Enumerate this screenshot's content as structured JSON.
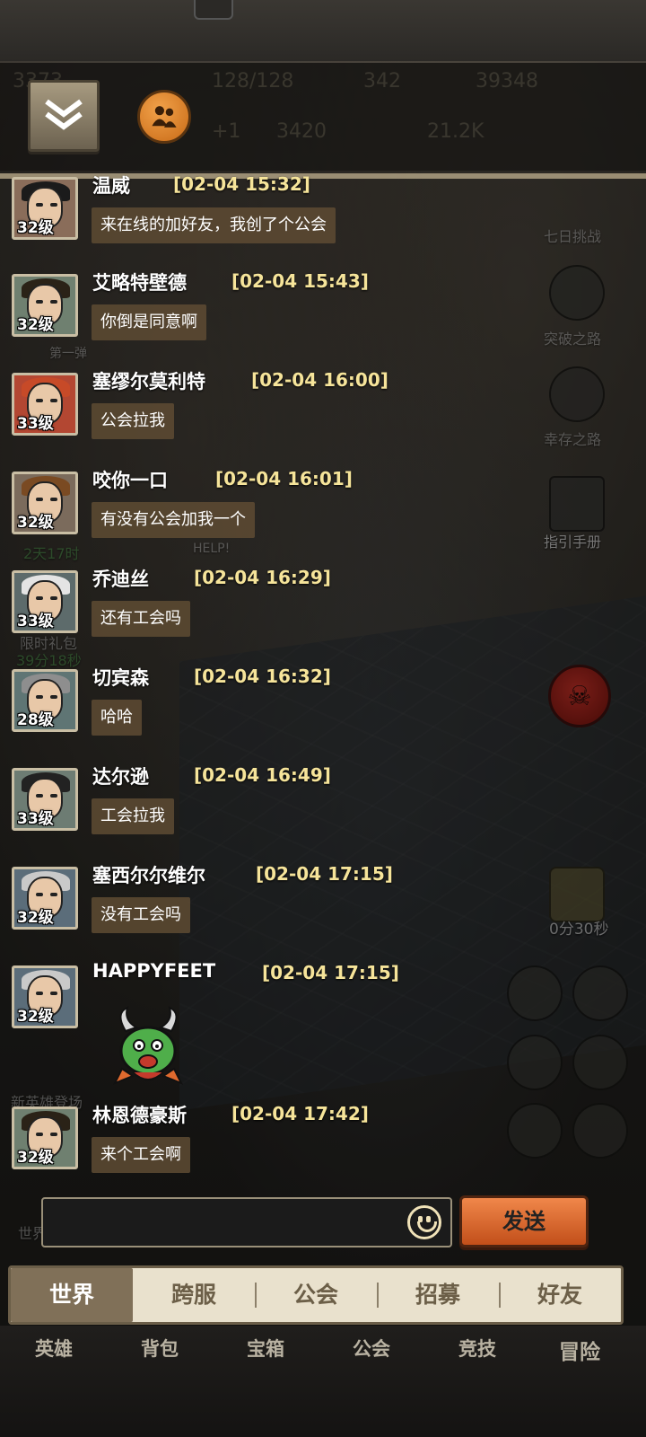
{
  "header": {
    "stats": [
      "3373",
      "128/128",
      "342",
      "39348",
      "3420",
      "+1",
      "21.2K"
    ],
    "collapse_icon": "double-chevron-down-icon",
    "friends_icon": "friends-icon"
  },
  "background": {
    "side_labels": [
      "七日挑战",
      "突破之路",
      "幸存之路",
      "指引手册",
      "0分30秒",
      "新英雄登场",
      "2天17时",
      "限时礼包",
      "39分18秒",
      "HELP!",
      "第一弹",
      "世界"
    ]
  },
  "messages": [
    {
      "name": "温威",
      "time": "[02-04  15:32]",
      "level": "32级",
      "text": "来在线的加好友，我创了个公会",
      "avatar_color": "#8a6d5a",
      "hair": "#1b1b1b"
    },
    {
      "name": "艾略特壁德",
      "time": "[02-04  15:43]",
      "level": "32级",
      "text": "你倒是同意啊",
      "avatar_color": "#6f8070",
      "hair": "#2a2217"
    },
    {
      "name": "塞缪尔莫利特",
      "time": "[02-04  16:00]",
      "level": "33级",
      "text": "公会拉我",
      "avatar_color": "#b34732",
      "hair": "#c74a28"
    },
    {
      "name": "咬你一口",
      "time": "[02-04  16:01]",
      "level": "32级",
      "text": "有没有公会加我一个",
      "avatar_color": "#7b6b5c",
      "hair": "#7a4a22"
    },
    {
      "name": "乔迪丝",
      "time": "[02-04  16:29]",
      "level": "33级",
      "text": "还有工会吗",
      "avatar_color": "#5d6b6b",
      "hair": "#e4e4e4"
    },
    {
      "name": "切宾森",
      "time": "[02-04  16:32]",
      "level": "28级",
      "text": "哈哈",
      "avatar_color": "#5f7574",
      "hair": "#8e8e8e"
    },
    {
      "name": "达尔逊",
      "time": "[02-04  16:49]",
      "level": "33级",
      "text": "工会拉我",
      "avatar_color": "#6d7c73",
      "hair": "#222222"
    },
    {
      "name": "塞西尔尔维尔",
      "time": "[02-04  17:15]",
      "level": "32级",
      "text": "没有工会吗",
      "avatar_color": "#5b6d7a",
      "hair": "#c9c9c9"
    },
    {
      "name": "HAPPYFEET",
      "time": "[02-04  17:15]",
      "level": "32级",
      "text": "",
      "avatar_color": "#5b6d7a",
      "hair": "#c9c9c9"
    },
    {
      "name": "林恩德豪斯",
      "time": "[02-04  17:42]",
      "level": "32级",
      "text": "来个工会啊",
      "avatar_color": "#6f8070",
      "hair": "#2a2217"
    }
  ],
  "sticker": {
    "icon": "green-monster-sticker-icon"
  },
  "input": {
    "placeholder": "",
    "emoji_icon": "smiley-icon",
    "send_label": "发送"
  },
  "tabs": [
    {
      "label": "世界",
      "active": true
    },
    {
      "label": "跨服",
      "active": false
    },
    {
      "label": "公会",
      "active": false
    },
    {
      "label": "招募",
      "active": false
    },
    {
      "label": "好友",
      "active": false
    }
  ],
  "bottom_nav": [
    "英雄",
    "背包",
    "宝箱",
    "公会",
    "竞技",
    "冒险"
  ],
  "colors": {
    "time": "#f6e49a",
    "bubble": "#5c4a32",
    "send": "#e06a2e",
    "tab_active": "#807058"
  }
}
